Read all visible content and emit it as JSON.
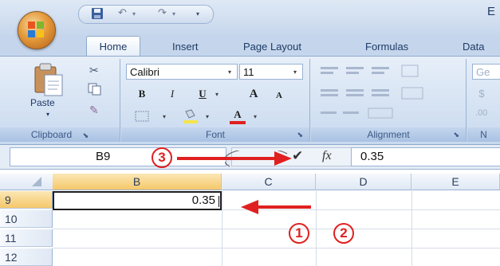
{
  "window": {
    "title_fragment": "E"
  },
  "ribbon": {
    "tabs": [
      {
        "label": "Home",
        "active": true
      },
      {
        "label": "Insert",
        "active": false
      },
      {
        "label": "Page Layout",
        "active": false
      },
      {
        "label": "Formulas",
        "active": false
      },
      {
        "label": "Data",
        "active": false
      }
    ],
    "clipboard": {
      "paste_label": "Paste",
      "group_label": "Clipboard"
    },
    "font": {
      "font_name": "Calibri",
      "font_size": "11",
      "bold": "B",
      "italic": "I",
      "underline": "U",
      "grow": "A",
      "shrink": "A",
      "font_color": "A",
      "group_label": "Font"
    },
    "alignment": {
      "group_label": "Alignment"
    },
    "number": {
      "format_fragment": "Ge",
      "currency": "$",
      "group_label_fragment": "N"
    }
  },
  "formula_bar": {
    "name_box": "B9",
    "enter_glyph": "✔",
    "fx_glyph": "fx",
    "formula": "0.35"
  },
  "grid": {
    "columns": [
      "B",
      "C",
      "D",
      "E"
    ],
    "active_column": "B",
    "rows": [
      "9",
      "10",
      "11",
      "12"
    ],
    "active_row": "9",
    "active_cell_value": "0.35"
  },
  "annotations": {
    "marker_1": "1",
    "marker_2": "2",
    "marker_3": "3",
    "color": "#e02020"
  },
  "colors": {
    "ribbon_blue": "#c5d6ec",
    "office_orange": "#e49a3a",
    "active_header": "#f5c86a",
    "annotation_red": "#e02020"
  }
}
